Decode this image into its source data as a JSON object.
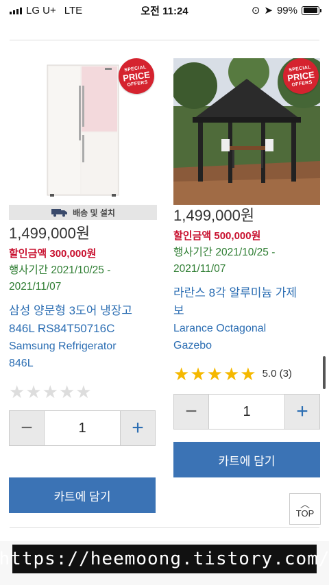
{
  "status_bar": {
    "carrier": "LG U+",
    "network": "LTE",
    "time": "오전 11:24",
    "battery": "99%",
    "battery_level": 0.99
  },
  "colors": {
    "link_blue": "#2c6eb3",
    "discount_red": "#c8102e",
    "period_green": "#2e7d32",
    "cart_button": "#3b73b5",
    "badge_red": "#d5232f",
    "star_gold": "#f5b800"
  },
  "badge": {
    "line1": "SPECIAL",
    "line2": "PRICE",
    "line3": "OFFERS"
  },
  "products": [
    {
      "image_icon": "refrigerator-image",
      "delivery_label": "배송 및 설치",
      "price": "1,499,000원",
      "discount_label": "할인금액",
      "discount_value": "300,000원",
      "period_line1": "행사기간 2021/10/25 -",
      "period_line2": "2021/11/07",
      "title_ko_line1": "삼성 양문형 3도어 냉장고",
      "title_ko_line2": "846L RS84T50716C",
      "title_en_line1": "Samsung Refrigerator",
      "title_en_line2": "846L",
      "rating": 0,
      "rating_text": "",
      "quantity": "1",
      "cart_label": "카트에 담기"
    },
    {
      "image_icon": "gazebo-image",
      "price": "1,499,000원",
      "discount_label": "할인금액",
      "discount_value": "500,000원",
      "period_line1": "행사기간 2021/10/25 -",
      "period_line2": "2021/11/07",
      "title_ko_line1": "라란스 8각 알루미늄 가제",
      "title_ko_line2": "보",
      "title_en_line1": "Larance Octagonal",
      "title_en_line2": "Gazebo",
      "rating": 5,
      "rating_text": "5.0 (3)",
      "quantity": "1",
      "cart_label": "카트에 담기"
    }
  ],
  "top_button": {
    "label": "TOP"
  },
  "watermark": "https://heemoong.tistory.com/"
}
